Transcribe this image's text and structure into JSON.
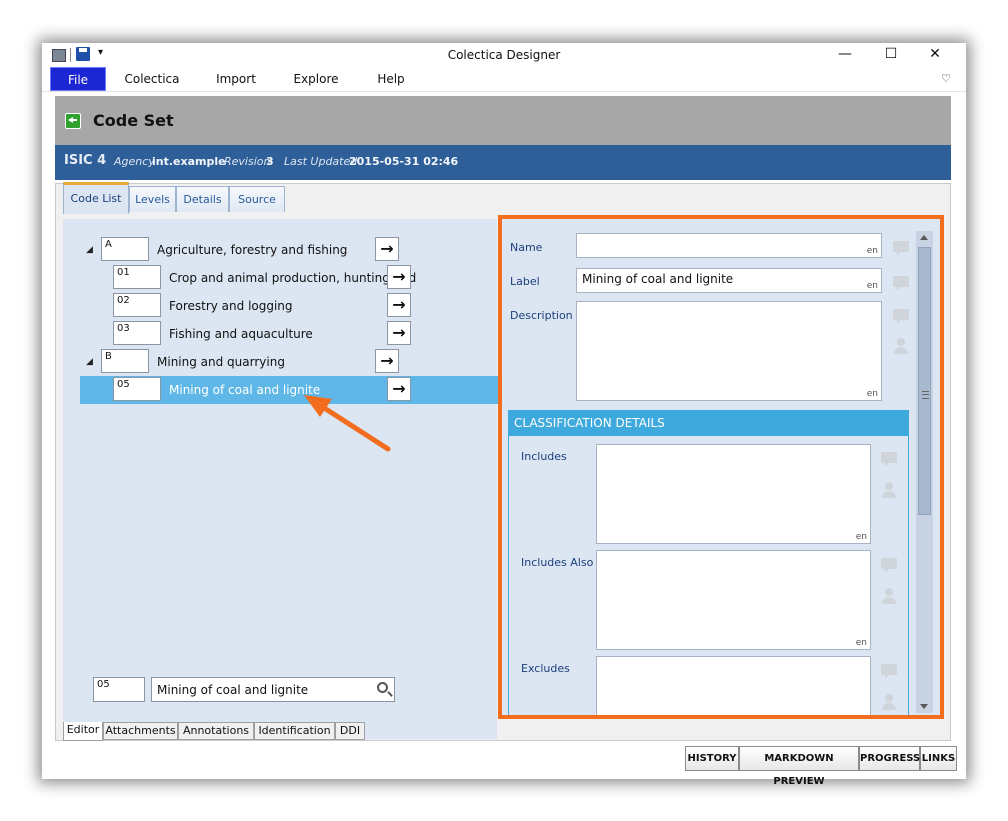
{
  "window": {
    "title": "Colectica Designer",
    "minimize": "—",
    "maximize": "☐",
    "close": "✕"
  },
  "quick_access": {
    "overflow": "▾"
  },
  "menu": {
    "items": [
      "File",
      "Colectica",
      "Import",
      "Explore",
      "Help"
    ],
    "ribbon_toggle": "♡"
  },
  "header": {
    "title": "Code Set"
  },
  "info": {
    "name": "ISIC 4",
    "agency_label": "Agency",
    "agency_value": "int.example",
    "revision_label": "Revision",
    "revision_value": "3",
    "updated_label": "Last Updated",
    "updated_value": "2015-05-31 02:46"
  },
  "tabs": [
    "Code List",
    "Levels",
    "Details",
    "Source"
  ],
  "tree": [
    {
      "code": "A",
      "label": "Agriculture, forestry and fishing",
      "level": 0,
      "expander": "◢"
    },
    {
      "code": "01",
      "label": "Crop and animal production, hunting and",
      "level": 1
    },
    {
      "code": "02",
      "label": "Forestry and logging",
      "level": 1
    },
    {
      "code": "03",
      "label": "Fishing and aquaculture",
      "level": 1
    },
    {
      "code": "B",
      "label": "Mining and quarrying",
      "level": 0,
      "expander": "◢"
    },
    {
      "code": "05",
      "label": "Mining of coal and lignite",
      "level": 1,
      "selected": true
    }
  ],
  "search": {
    "code": "05",
    "value": "Mining of coal and lignite"
  },
  "details": {
    "name_label": "Name",
    "name_value": "",
    "name_lang": "en",
    "label_label": "Label",
    "label_value": "Mining of coal and lignite",
    "label_lang": "en",
    "description_label": "Description",
    "description_lang": "en",
    "classification_header": "CLASSIFICATION DETAILS",
    "includes_label": "Includes",
    "includes_lang": "en",
    "includes_also_label": "Includes Also",
    "includes_also_lang": "en",
    "excludes_label": "Excludes"
  },
  "bottom_tabs": [
    "Editor",
    "Attachments",
    "Annotations",
    "Identification",
    "DDI"
  ],
  "actions": [
    "HISTORY",
    "MARKDOWN PREVIEW",
    "PROGRESS",
    "LINKS"
  ],
  "colors": {
    "accent_orange": "#f26d1e",
    "selection": "#5eb7e6",
    "infobar": "#2f5f98",
    "file_menu": "#1d26d3"
  }
}
